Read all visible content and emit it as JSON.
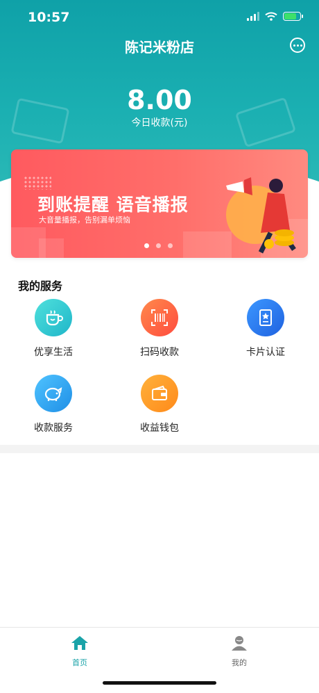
{
  "status_bar": {
    "time": "10:57"
  },
  "header": {
    "title": "陈记米粉店"
  },
  "summary": {
    "amount": "8.00",
    "label": "今日收款(元)"
  },
  "banner": {
    "title": "到账提醒 语音播报",
    "subtitle": "大音量播报，告别漏单烦恼",
    "pages": 3,
    "active_page": 1
  },
  "services": {
    "title": "我的服务",
    "items": [
      {
        "label": "优享生活",
        "icon": "coffee-cup-icon",
        "color": "#2fc6cf"
      },
      {
        "label": "扫码收款",
        "icon": "barcode-scan-icon",
        "color": "#ff6a3d"
      },
      {
        "label": "卡片认证",
        "icon": "card-star-icon",
        "color": "#2f7bf0"
      },
      {
        "label": "收款服务",
        "icon": "piggy-bank-icon",
        "color": "#2fa8ee"
      },
      {
        "label": "收益钱包",
        "icon": "wallet-icon",
        "color": "#ff9a1f"
      }
    ]
  },
  "tabbar": {
    "tabs": [
      {
        "label": "首页",
        "icon": "home-icon",
        "active": true
      },
      {
        "label": "我的",
        "icon": "profile-icon",
        "active": false
      }
    ],
    "active_color": "#1aa3a8",
    "inactive_color": "#666666"
  }
}
